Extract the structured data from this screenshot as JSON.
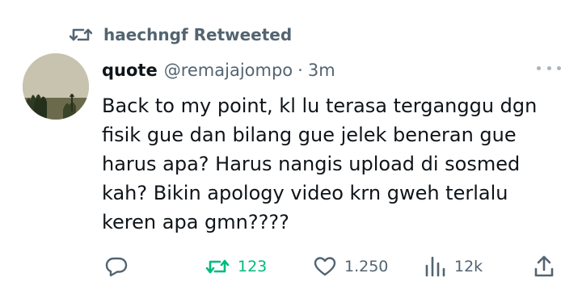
{
  "social_context": {
    "text": "haechngf Retweeted",
    "icon": "retweet-icon"
  },
  "tweet": {
    "display_name": "quote",
    "handle": "@remajajompo",
    "separator": "·",
    "timestamp": "3m",
    "text": "Back to my point, kl lu terasa terganggu dgn\nfisik gue dan bilang gue jelek beneran gue\nharus apa? Harus nangis upload di sosmed\nkah? Bikin apology video krn gweh terlalu\nkeren apa gmn????"
  },
  "actions": {
    "reply": {
      "icon": "reply-icon",
      "count": ""
    },
    "retweet": {
      "icon": "retweet-icon",
      "count": "123",
      "active": true,
      "color": "#00ba7c"
    },
    "like": {
      "icon": "heart-icon",
      "count": "1.250"
    },
    "views": {
      "icon": "views-icon",
      "count": "12k"
    },
    "share": {
      "icon": "share-icon"
    }
  },
  "colors": {
    "text": "#0f1419",
    "secondary": "#536471",
    "retweet_active": "#00ba7c"
  }
}
